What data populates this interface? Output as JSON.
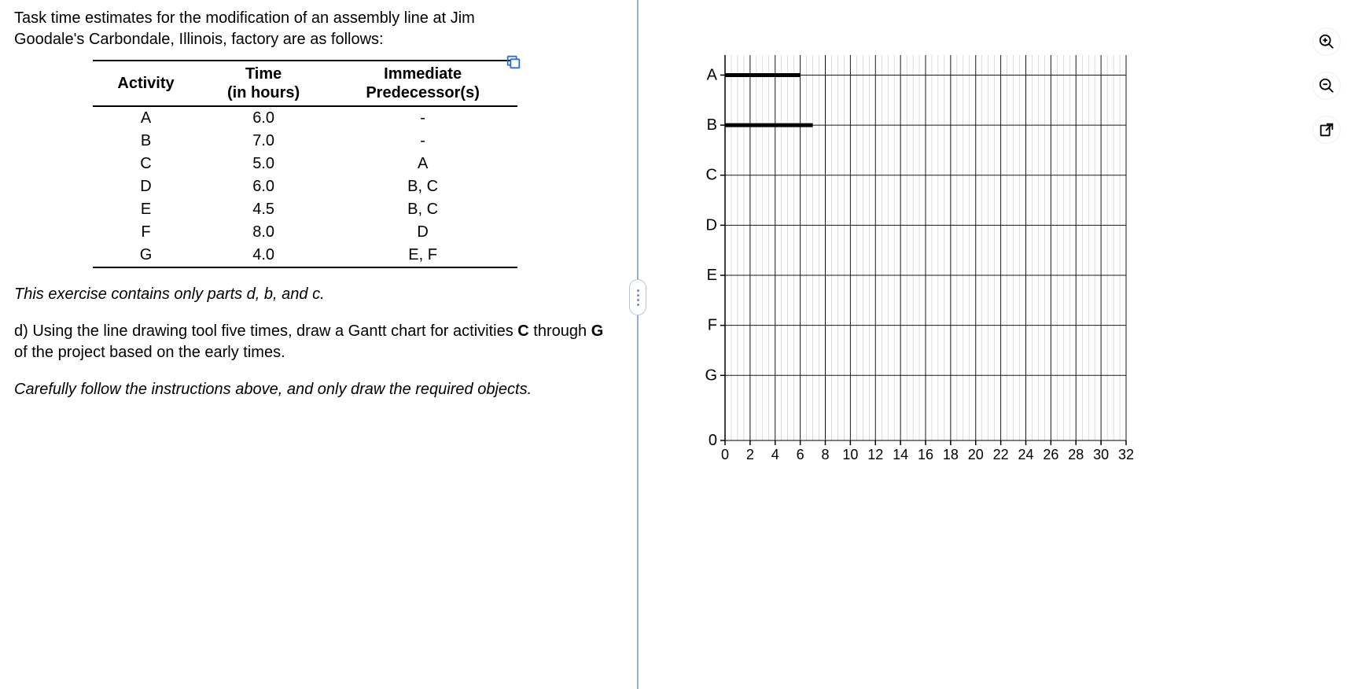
{
  "intro": "Task time estimates for the modification of an assembly line at Jim Goodale's Carbondale, Illinois, factory are as follows:",
  "table": {
    "headers": {
      "activity": "Activity",
      "time_line1": "Time",
      "time_line2": "(in hours)",
      "pred_line1": "Immediate",
      "pred_line2": "Predecessor(s)"
    },
    "rows": [
      {
        "activity": "A",
        "time": "6.0",
        "pred": "-"
      },
      {
        "activity": "B",
        "time": "7.0",
        "pred": "-"
      },
      {
        "activity": "C",
        "time": "5.0",
        "pred": "A"
      },
      {
        "activity": "D",
        "time": "6.0",
        "pred": "B, C"
      },
      {
        "activity": "E",
        "time": "4.5",
        "pred": "B, C"
      },
      {
        "activity": "F",
        "time": "8.0",
        "pred": "D"
      },
      {
        "activity": "G",
        "time": "4.0",
        "pred": "E, F"
      }
    ]
  },
  "note": "This exercise contains only parts d, b, and c.",
  "question_d_prefix": "d) Using the line drawing tool five times, draw a Gantt chart for activities ",
  "question_d_bold1": "C",
  "question_d_mid": " through ",
  "question_d_bold2": "G",
  "question_d_suffix": " of the project based on the early times.",
  "caution": "Carefully follow the instructions above, and only draw the required objects.",
  "chart_data": {
    "type": "gantt",
    "x_range": [
      0,
      32
    ],
    "x_ticks": [
      0,
      2,
      4,
      6,
      8,
      10,
      12,
      14,
      16,
      18,
      20,
      22,
      24,
      26,
      28,
      30,
      32
    ],
    "y_categories": [
      "A",
      "B",
      "C",
      "D",
      "E",
      "F",
      "G"
    ],
    "origin_label": "0",
    "drawn_bars": [
      {
        "name": "A",
        "start": 0,
        "end": 6
      },
      {
        "name": "B",
        "start": 0,
        "end": 7
      }
    ]
  },
  "tools": {
    "zoom_in": "zoom-in",
    "zoom_out": "zoom-out",
    "open_new": "open-in-new"
  }
}
